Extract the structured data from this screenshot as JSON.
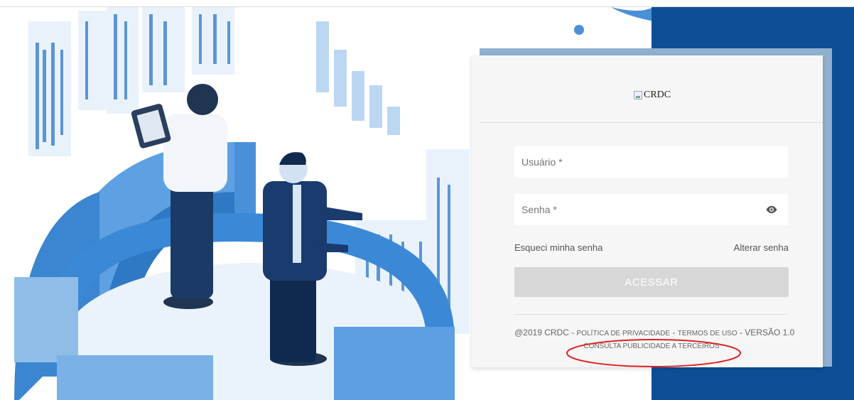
{
  "logo": {
    "alt_text": "CRDC"
  },
  "form": {
    "username_placeholder": "Usuário *",
    "password_placeholder": "Senha *",
    "forgot_password": "Esqueci minha senha",
    "change_password": "Alterar senha",
    "submit_label": "ACESSAR"
  },
  "footer": {
    "copyright": "@2019 CRDC - ",
    "privacy": "POLÍTICA DE PRIVACIDADE",
    "sep1": " - ",
    "terms": "TERMOS DE USO",
    "version": " - VERSÃO 1.0",
    "third_party": "CONSULTA PUBLICIDADE A TERCEIROS"
  },
  "colors": {
    "blue_panel": "#0d4f96",
    "annotation": "#e02020",
    "button_disabled": "#d7d7d7"
  }
}
